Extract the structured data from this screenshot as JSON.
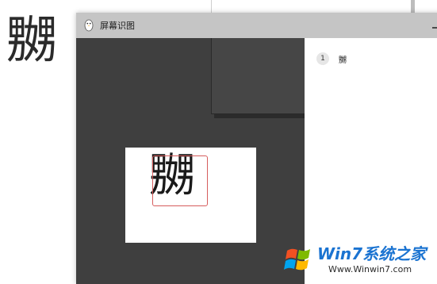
{
  "background": {
    "big_char": "嬲"
  },
  "window": {
    "title": "屏幕识图",
    "icon": "penguin-icon",
    "minimize_icon": "minimize-icon"
  },
  "capture": {
    "snap_char": "嬲"
  },
  "results": {
    "items": [
      {
        "index": "1",
        "text": "嬲"
      }
    ]
  },
  "watermark": {
    "brand": "Win7系统之家",
    "url": "Www.Winwin7.com",
    "logo_icon": "windows-flag-icon"
  },
  "colors": {
    "titlebar": "#c5c5c5",
    "dark_area": "#3f3f3f",
    "box_outline": "#d65d5d",
    "watermark_blue": "#1a73d1"
  }
}
